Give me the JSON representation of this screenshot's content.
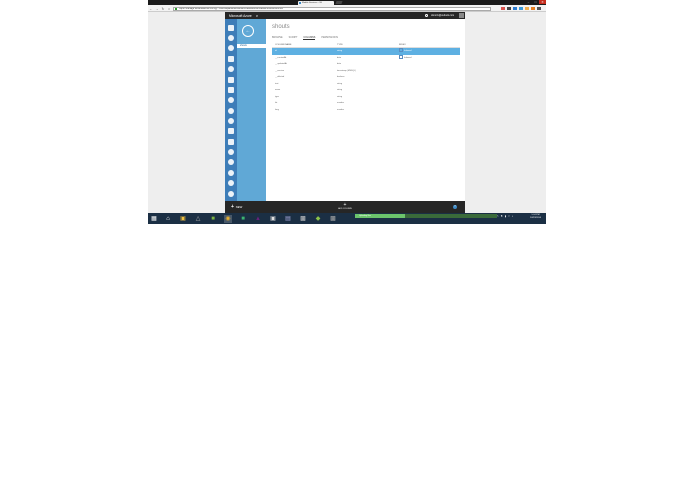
{
  "browser": {
    "tab_title": "Mobile Services - Wi",
    "address": "https://manage.windowsazure.com/@...#Workspaces/MobileServicesExtension/tables/shouts/columns",
    "nav": {
      "back": "←",
      "forward": "→",
      "reload": "↻",
      "home": "⌂"
    },
    "window_controls": {
      "minimize": "–",
      "maximize": "□",
      "close": "✕"
    }
  },
  "portal": {
    "brand": "Microsoft Azure",
    "brand_chevron": "∨",
    "user": "dxnortx@outlook.com",
    "back_arrow": "←",
    "subnav_item": "shouts",
    "page_title": "shouts",
    "tabs": [
      {
        "label": "BROWSE",
        "active": false
      },
      {
        "label": "SCRIPT",
        "active": false
      },
      {
        "label": "COLUMNS",
        "active": true
      },
      {
        "label": "PERMISSIONS",
        "active": false
      }
    ],
    "grid": {
      "headers": [
        "COLUMN NAME",
        "TYPE",
        "INDEX"
      ],
      "rows": [
        {
          "name": "id",
          "type": "string",
          "index": "Indexed",
          "selected": true
        },
        {
          "name": "__createdAt",
          "type": "date",
          "index": "Indexed",
          "selected": false
        },
        {
          "name": "__updatedAt",
          "type": "date",
          "index": "",
          "selected": false
        },
        {
          "name": "__version",
          "type": "timestamp (MSSQL)",
          "index": "",
          "selected": false
        },
        {
          "name": "__deleted",
          "type": "boolean",
          "index": "",
          "selected": false
        },
        {
          "name": "text",
          "type": "string",
          "index": "",
          "selected": false
        },
        {
          "name": "name",
          "type": "string",
          "index": "",
          "selected": false
        },
        {
          "name": "type",
          "type": "string",
          "index": "",
          "selected": false
        },
        {
          "name": "lat",
          "type": "number",
          "index": "",
          "selected": false
        },
        {
          "name": "long",
          "type": "number",
          "index": "",
          "selected": false
        }
      ]
    },
    "commands": {
      "new_label": "NEW",
      "center_label": "ADD COLUMN",
      "help": "?"
    }
  },
  "taskbar": {
    "progress_fraction": 0.35,
    "progress_text": "Uploading files",
    "clock_time": "1:24 PM",
    "clock_date": "10/23/2014"
  },
  "colors": {
    "azure_topbar": "#262626",
    "azure_nav": "#3e7db8",
    "azure_subnav": "#60a8d6",
    "selected_row": "#5eb0e2",
    "taskbar": "#1b2f44"
  }
}
